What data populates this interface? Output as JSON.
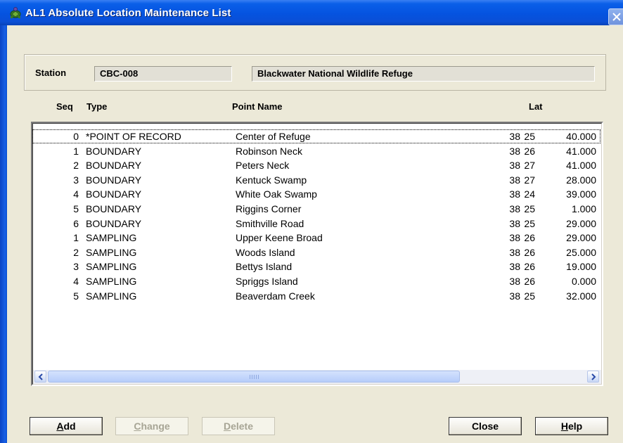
{
  "window": {
    "title": "AL1 Absolute Location Maintenance List",
    "icon": "turtle-icon"
  },
  "station": {
    "label": "Station",
    "code": "CBC-008",
    "name": "Blackwater National Wildlife Refuge"
  },
  "columns": {
    "seq": "Seq",
    "type": "Type",
    "point_name": "Point Name",
    "lat": "Lat"
  },
  "rows": [
    {
      "seq": "0",
      "type": "*POINT OF RECORD",
      "point_name": "Center of Refuge",
      "lat_deg": "38",
      "lat_min": "25",
      "lat_sec": "40.000"
    },
    {
      "seq": "1",
      "type": "BOUNDARY",
      "point_name": "Robinson Neck",
      "lat_deg": "38",
      "lat_min": "26",
      "lat_sec": "41.000"
    },
    {
      "seq": "2",
      "type": "BOUNDARY",
      "point_name": "Peters Neck",
      "lat_deg": "38",
      "lat_min": "27",
      "lat_sec": "41.000"
    },
    {
      "seq": "3",
      "type": "BOUNDARY",
      "point_name": "Kentuck Swamp",
      "lat_deg": "38",
      "lat_min": "27",
      "lat_sec": "28.000"
    },
    {
      "seq": "4",
      "type": "BOUNDARY",
      "point_name": "White Oak Swamp",
      "lat_deg": "38",
      "lat_min": "24",
      "lat_sec": "39.000"
    },
    {
      "seq": "5",
      "type": "BOUNDARY",
      "point_name": "Riggins Corner",
      "lat_deg": "38",
      "lat_min": "25",
      "lat_sec": "1.000"
    },
    {
      "seq": "6",
      "type": "BOUNDARY",
      "point_name": "Smithville Road",
      "lat_deg": "38",
      "lat_min": "25",
      "lat_sec": "29.000"
    },
    {
      "seq": "1",
      "type": "SAMPLING",
      "point_name": "Upper Keene Broad",
      "lat_deg": "38",
      "lat_min": "26",
      "lat_sec": "29.000"
    },
    {
      "seq": "2",
      "type": "SAMPLING",
      "point_name": "Woods Island",
      "lat_deg": "38",
      "lat_min": "26",
      "lat_sec": "25.000"
    },
    {
      "seq": "3",
      "type": "SAMPLING",
      "point_name": "Bettys Island",
      "lat_deg": "38",
      "lat_min": "26",
      "lat_sec": "19.000"
    },
    {
      "seq": "4",
      "type": "SAMPLING",
      "point_name": "Spriggs Island",
      "lat_deg": "38",
      "lat_min": "26",
      "lat_sec": "0.000"
    },
    {
      "seq": "5",
      "type": "SAMPLING",
      "point_name": "Beaverdam Creek",
      "lat_deg": "38",
      "lat_min": "25",
      "lat_sec": "32.000"
    }
  ],
  "buttons": {
    "add": {
      "mnemonic": "A",
      "rest": "dd"
    },
    "change": {
      "mnemonic": "C",
      "rest": "hange"
    },
    "delete": {
      "mnemonic": "D",
      "rest": "elete"
    },
    "close": {
      "label": "Close"
    },
    "help": {
      "mnemonic": "H",
      "rest": "elp"
    }
  }
}
